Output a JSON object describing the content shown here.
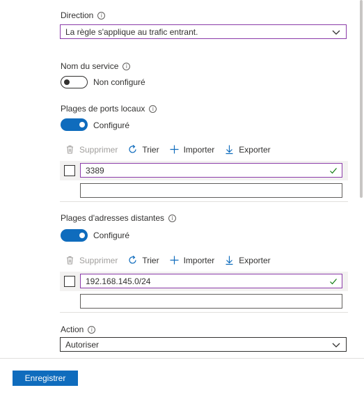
{
  "direction": {
    "label": "Direction",
    "value": "La règle s'applique au trafic entrant."
  },
  "service_name": {
    "label": "Nom du service",
    "toggle_text": "Non configuré",
    "enabled": false
  },
  "local_ports": {
    "label": "Plages de ports locaux",
    "toggle_text": "Configuré",
    "enabled": true,
    "toolbar": {
      "delete": "Supprimer",
      "sort": "Trier",
      "import": "Importer",
      "export": "Exporter"
    },
    "entries": [
      "3389"
    ],
    "new_entry": ""
  },
  "remote_addresses": {
    "label": "Plages d'adresses distantes",
    "toggle_text": "Configuré",
    "enabled": true,
    "toolbar": {
      "delete": "Supprimer",
      "sort": "Trier",
      "import": "Importer",
      "export": "Exporter"
    },
    "entries": [
      "192.168.145.0/24"
    ],
    "new_entry": ""
  },
  "action": {
    "label": "Action",
    "value": "Autoriser"
  },
  "footer": {
    "save_label": "Enregistrer"
  },
  "colors": {
    "accent": "#0f6cbd",
    "valid_border": "#8a3aa8",
    "check": "#107c10",
    "disabled": "#a19f9d"
  },
  "info_glyph": "i"
}
